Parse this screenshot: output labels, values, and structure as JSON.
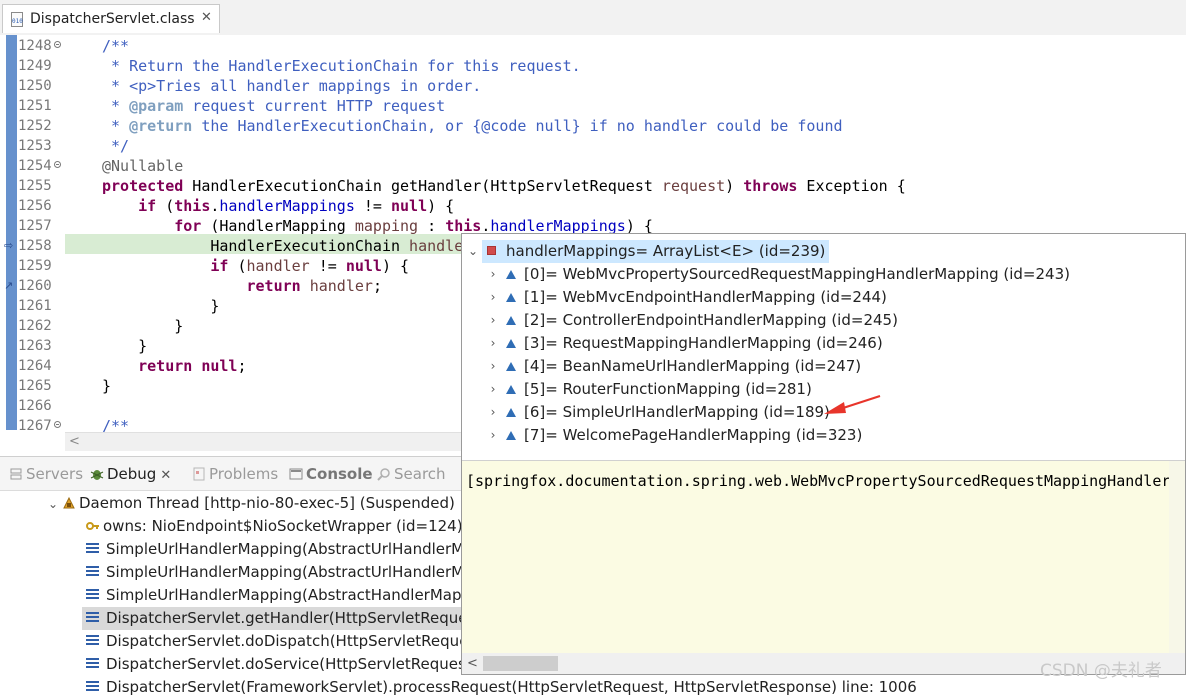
{
  "editor_tab": {
    "title": "DispatcherServlet.class",
    "icon": "class-file-icon",
    "icon_text": "010"
  },
  "code_lines": [
    {
      "no": "1248",
      "fold": true
    },
    {
      "no": "1249"
    },
    {
      "no": "1250"
    },
    {
      "no": "1251"
    },
    {
      "no": "1252"
    },
    {
      "no": "1253"
    },
    {
      "no": "1254",
      "fold": true
    },
    {
      "no": "1255"
    },
    {
      "no": "1256"
    },
    {
      "no": "1257"
    },
    {
      "no": "1258",
      "current": true
    },
    {
      "no": "1259"
    },
    {
      "no": "1260"
    },
    {
      "no": "1261"
    },
    {
      "no": "1262"
    },
    {
      "no": "1263"
    },
    {
      "no": "1264"
    },
    {
      "no": "1265"
    },
    {
      "no": "1266"
    },
    {
      "no": "1267",
      "fold": true
    }
  ],
  "code_text": {
    "l1248": "/**",
    "l1249": " * Return the HandlerExecutionChain for this request.",
    "l1250": " * <p>Tries all handler mappings in order.",
    "l1251a": " * ",
    "l1251b": "@param",
    "l1251c": " request current HTTP request",
    "l1252a": " * ",
    "l1252b": "@return",
    "l1252c": " the HandlerExecutionChain, or {@code null} if no handler could be found",
    "l1253": " */",
    "l1254": "@Nullable",
    "l1255a": "protected",
    "l1255b": " HandlerExecutionChain getHandler(HttpServletRequest ",
    "l1255c": "request",
    "l1255d": ") ",
    "l1255e": "throws",
    "l1255f": " Exception {",
    "l1256a": "    ",
    "l1256b": "if",
    "l1256c": " (",
    "l1256d": "this",
    "l1256e": ".",
    "l1256f": "handlerMappings",
    "l1256g": " != ",
    "l1256h": "null",
    "l1256i": ") {",
    "l1257a": "        ",
    "l1257b": "for",
    "l1257c": " (HandlerMapping ",
    "l1257d": "mapping",
    "l1257e": " : ",
    "l1257f": "this",
    "l1257g": ".",
    "l1257h": "handlerMappings",
    "l1257i": ") {",
    "l1258a": "            HandlerExecutionChain ",
    "l1258b": "handle",
    "l1259a": "            ",
    "l1259b": "if",
    "l1259c": " (",
    "l1259d": "handler",
    "l1259e": " != ",
    "l1259f": "null",
    "l1259g": ") {",
    "l1260a": "                ",
    "l1260b": "return",
    "l1260c": " ",
    "l1260d": "handler",
    "l1260e": ";",
    "l1261": "            }",
    "l1262": "        }",
    "l1263": "    }",
    "l1264a": "    ",
    "l1264b": "return",
    "l1264c": " ",
    "l1264d": "null",
    "l1264e": ";",
    "l1265": "}",
    "l1266": "",
    "l1267": "/**"
  },
  "views": [
    {
      "label": "Servers",
      "icon": "servers-icon",
      "active": false
    },
    {
      "label": "Debug",
      "icon": "debug-icon",
      "active": true,
      "close": "✕"
    },
    {
      "label": "Problems",
      "icon": "problems-icon",
      "active": false
    },
    {
      "label": "Console",
      "icon": "console-icon",
      "active": false
    },
    {
      "label": "Search",
      "icon": "search-icon",
      "active": false
    }
  ],
  "debug": {
    "thread": "Daemon Thread [http-nio-80-exec-5] (Suspended)",
    "owns": "owns: NioEndpoint$NioSocketWrapper  (id=124)",
    "frames": [
      "SimpleUrlHandlerMapping(AbstractUrlHandlerM",
      "SimpleUrlHandlerMapping(AbstractUrlHandlerM",
      "SimpleUrlHandlerMapping(AbstractHandlerMapp",
      "DispatcherServlet.getHandler(HttpServletReques",
      "DispatcherServlet.doDispatch(HttpServletReques",
      "DispatcherServlet.doService(HttpServletRequest",
      "DispatcherServlet(FrameworkServlet).processRequest(HttpServletRequest, HttpServletResponse) line: 1006"
    ],
    "selected_frame": 3
  },
  "popup": {
    "root": "handlerMappings= ArrayList<E>  (id=239)",
    "items": [
      "[0]= WebMvcPropertySourcedRequestMappingHandlerMapping  (id=243)",
      "[1]= WebMvcEndpointHandlerMapping  (id=244)",
      "[2]= ControllerEndpointHandlerMapping  (id=245)",
      "[3]= RequestMappingHandlerMapping  (id=246)",
      "[4]= BeanNameUrlHandlerMapping  (id=247)",
      "[5]= RouterFunctionMapping  (id=281)",
      "[6]= SimpleUrlHandlerMapping  (id=189)",
      "[7]= WelcomePageHandlerMapping  (id=323)"
    ],
    "detail": "[springfox.documentation.spring.web.WebMvcPropertySourcedRequestMappingHandlerMapping"
  },
  "watermark": "CSDN @夫礼者",
  "colors": {
    "keyword": "#7f0055",
    "comment": "#3f5fbf",
    "field": "#0000c0",
    "current_line": "#d8ecd3",
    "popup_bg": "#fbfbe3",
    "arrow": "#e8352b"
  }
}
